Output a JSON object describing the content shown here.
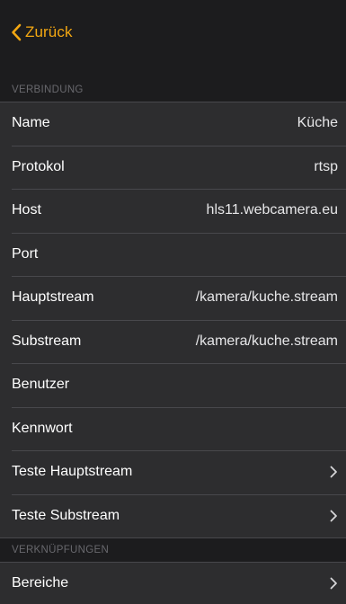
{
  "nav": {
    "back_label": "Zurück"
  },
  "colors": {
    "accent": "#f3a712",
    "background": "#1c1c1e",
    "cell": "#2d2d2f",
    "separator": "#48484c"
  },
  "sections": {
    "connection": {
      "header": "VERBINDUNG",
      "rows": [
        {
          "label": "Name",
          "value": "Küche"
        },
        {
          "label": "Protokol",
          "value": "rtsp"
        },
        {
          "label": "Host",
          "value": "hls11.webcamera.eu"
        },
        {
          "label": "Port",
          "value": ""
        },
        {
          "label": "Hauptstream",
          "value": "/kamera/kuche.stream"
        },
        {
          "label": "Substream",
          "value": "/kamera/kuche.stream"
        },
        {
          "label": "Benutzer",
          "value": ""
        },
        {
          "label": "Kennwort",
          "value": ""
        },
        {
          "label": "Teste Hauptstream",
          "icon": "chevron-right-icon"
        },
        {
          "label": "Teste Substream",
          "icon": "chevron-right-icon"
        }
      ]
    },
    "links": {
      "header": "VERKNÜPFUNGEN",
      "rows": [
        {
          "label": "Bereiche",
          "icon": "chevron-right-icon"
        }
      ]
    }
  }
}
